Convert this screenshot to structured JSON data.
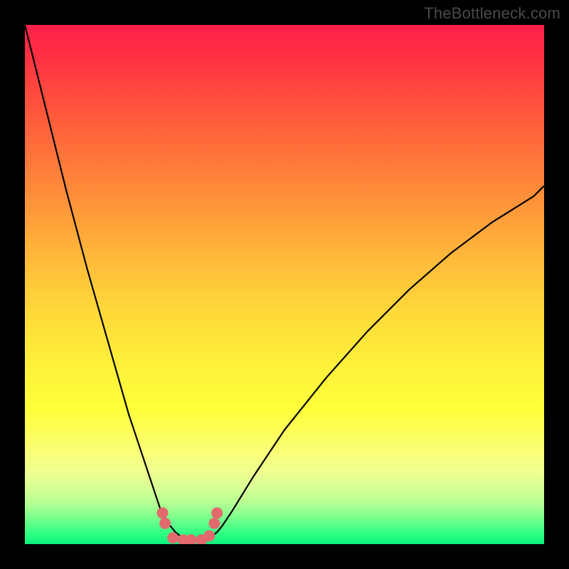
{
  "watermark": "TheBottleneck.com",
  "chart_data": {
    "type": "line",
    "title": "",
    "xlabel": "",
    "ylabel": "",
    "xlim": [
      0,
      100
    ],
    "ylim": [
      0,
      100
    ],
    "grid": false,
    "legend": false,
    "series": [
      {
        "name": "left-curve",
        "stroke": "#000000",
        "x": [
          0,
          4,
          8,
          12,
          16,
          20,
          22,
          24,
          26,
          27,
          28,
          29,
          30,
          31,
          32,
          33
        ],
        "values": [
          100,
          84,
          68,
          53,
          39,
          25,
          19,
          13,
          7,
          5,
          3.5,
          2.3,
          1.5,
          1.0,
          0.8,
          0.7
        ]
      },
      {
        "name": "right-curve",
        "stroke": "#000000",
        "x": [
          33,
          34,
          35,
          36,
          37,
          38,
          40,
          44,
          50,
          58,
          66,
          74,
          82,
          90,
          98,
          100
        ],
        "values": [
          0.7,
          0.8,
          1.0,
          1.5,
          2.3,
          3.5,
          6.5,
          13,
          22,
          32,
          41,
          49,
          56,
          62,
          67,
          69
        ]
      },
      {
        "name": "trough-markers",
        "stroke": "#e26a6e",
        "marker": "circle",
        "x": [
          26.5,
          27.0,
          28.5,
          30.5,
          32.0,
          34.0,
          35.5,
          36.5,
          37.0
        ],
        "values": [
          6.0,
          4.0,
          1.2,
          0.8,
          0.8,
          0.8,
          1.6,
          4.0,
          6.0
        ]
      }
    ],
    "annotations": [
      {
        "text": "TheBottleneck.com",
        "position": "top-right",
        "color": "#4a4a4a"
      }
    ]
  }
}
